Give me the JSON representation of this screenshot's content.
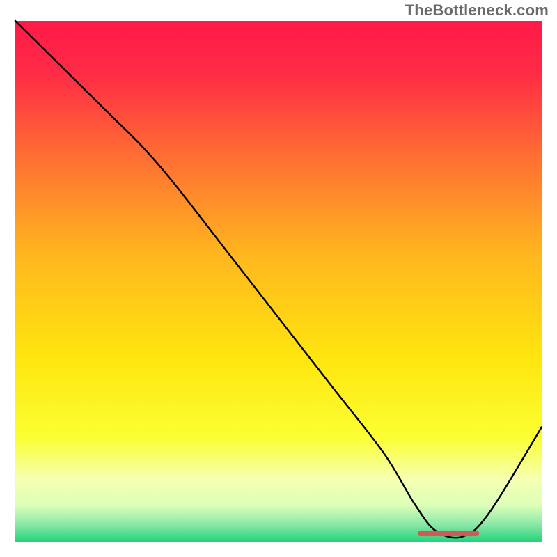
{
  "watermark": "TheBottleneck.com",
  "chart_data": {
    "type": "line",
    "title": "",
    "xlabel": "",
    "ylabel": "",
    "xlim": [
      0,
      100
    ],
    "ylim": [
      0,
      100
    ],
    "axes_visible": false,
    "grid": false,
    "background": {
      "type": "vertical-gradient",
      "stops": [
        {
          "pos": 0.0,
          "color": "#ff1a49"
        },
        {
          "pos": 0.1,
          "color": "#ff2b45"
        },
        {
          "pos": 0.25,
          "color": "#ff6a34"
        },
        {
          "pos": 0.45,
          "color": "#ffb71e"
        },
        {
          "pos": 0.65,
          "color": "#ffe60f"
        },
        {
          "pos": 0.8,
          "color": "#fbff33"
        },
        {
          "pos": 0.88,
          "color": "#f6ffb2"
        },
        {
          "pos": 0.93,
          "color": "#dcffb8"
        },
        {
          "pos": 0.965,
          "color": "#8fe9a9"
        },
        {
          "pos": 1.0,
          "color": "#24d37a"
        }
      ]
    },
    "series": [
      {
        "name": "bottleneck-curve",
        "color": "#000000",
        "width": 2.5,
        "x": [
          0,
          6,
          18,
          24,
          30,
          40,
          50,
          60,
          70,
          76,
          80,
          85,
          90,
          100
        ],
        "y": [
          100,
          94,
          82,
          76,
          69,
          56,
          43,
          30,
          17,
          7,
          2,
          1,
          5.5,
          22
        ]
      }
    ],
    "markers": [
      {
        "name": "optimal-range",
        "shape": "dashed-bar",
        "color": "#cf5a5a",
        "x_start": 77,
        "x_end": 88,
        "y": 1.6,
        "thickness": 1.1
      }
    ]
  }
}
